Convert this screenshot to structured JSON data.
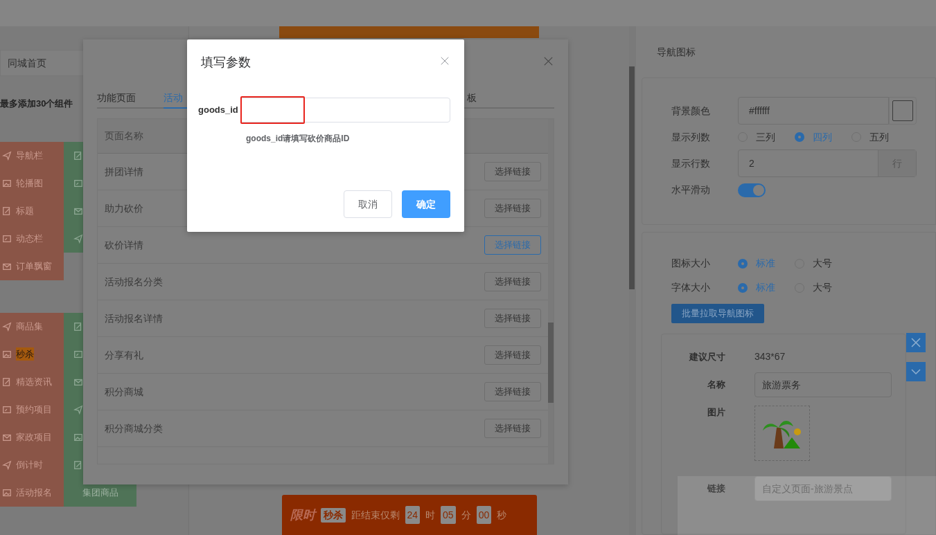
{
  "page_select": {
    "value": "同城首页"
  },
  "component_hint": "最多添加30个组件",
  "component_groups": [
    {
      "primary": [
        {
          "label": "导航栏",
          "highlighted": false
        },
        {
          "label": "轮播图",
          "highlighted": false
        },
        {
          "label": "标题",
          "highlighted": false
        },
        {
          "label": "动态栏",
          "highlighted": false
        },
        {
          "label": "订单飘窗",
          "highlighted": false
        }
      ],
      "secondary": [
        {
          "kind": "icon_only"
        },
        {
          "kind": "icon_only"
        },
        {
          "kind": "icon_only"
        },
        {
          "kind": "icon_only"
        }
      ]
    },
    {
      "primary": [
        {
          "label": "商品集",
          "highlighted": false
        },
        {
          "label": "秒杀",
          "highlighted": true
        },
        {
          "label": "精选资讯",
          "highlighted": false
        },
        {
          "label": "预约项目",
          "highlighted": false
        },
        {
          "label": "家政项目",
          "highlighted": false
        },
        {
          "label": "倒计时",
          "highlighted": false
        },
        {
          "label": "活动报名",
          "highlighted": false
        }
      ],
      "secondary": [
        {
          "kind": "icon_only"
        },
        {
          "kind": "icon_only"
        },
        {
          "kind": "icon_only"
        },
        {
          "kind": "icon_only"
        },
        {
          "kind": "icon_only"
        },
        {
          "kind": "icon_only"
        },
        {
          "kind": "text",
          "label": "集团商品"
        }
      ]
    }
  ],
  "flash_sale": {
    "title": "限时",
    "tag": "秒杀",
    "countdown_label": "距结束仅剩",
    "hours": "24",
    "hours_unit": "时",
    "minutes": "05",
    "minutes_unit": "分",
    "seconds": "00",
    "seconds_unit": "秒"
  },
  "link_modal": {
    "tabs": [
      {
        "label": "功能页面",
        "selected": false
      },
      {
        "label": "活动",
        "selected": true
      },
      {
        "label": "板",
        "selected": false
      }
    ],
    "column": "页面名称",
    "rows": [
      {
        "name": "拼团详情",
        "button": "选择链接",
        "selected": false
      },
      {
        "name": "助力砍价",
        "button": "选择链接",
        "selected": false
      },
      {
        "name": "砍价详情",
        "button": "选择链接",
        "selected": true
      },
      {
        "name": "活动报名分类",
        "button": "选择链接",
        "selected": false
      },
      {
        "name": "活动报名详情",
        "button": "选择链接",
        "selected": false
      },
      {
        "name": "分享有礼",
        "button": "选择链接",
        "selected": false
      },
      {
        "name": "积分商城",
        "button": "选择链接",
        "selected": false
      },
      {
        "name": "积分商城分类",
        "button": "选择链接",
        "selected": false
      }
    ]
  },
  "param_dialog": {
    "title": "填写参数",
    "field": {
      "label": "goods_id",
      "highlighted": true
    },
    "help": "goods_id请填写砍价商品ID",
    "buttons": [
      {
        "label": "取消",
        "kind": "secondary"
      },
      {
        "label": "确定",
        "kind": "primary"
      }
    ]
  },
  "settings": {
    "title": "导航图标",
    "background": {
      "label": "背景颜色",
      "value": "#ffffff"
    },
    "columns": {
      "label": "显示列数",
      "options": [
        {
          "label": "三列",
          "selected": false
        },
        {
          "label": "四列",
          "selected": true
        },
        {
          "label": "五列",
          "selected": false
        }
      ]
    },
    "rows": {
      "label": "显示行数",
      "value": "2",
      "unit": "行"
    },
    "scroll": {
      "label": "水平滑动",
      "on": true
    },
    "icon_size": {
      "label": "图标大小",
      "options": [
        {
          "label": "标准",
          "selected": true
        },
        {
          "label": "大号",
          "selected": false
        }
      ]
    },
    "font_size": {
      "label": "字体大小",
      "options": [
        {
          "label": "标准",
          "selected": true
        },
        {
          "label": "大号",
          "selected": false
        }
      ]
    },
    "batch_button": "批量拉取导航图标",
    "nav_item": {
      "size_label": "建议尺寸",
      "size_value": "343*67",
      "name_label": "名称",
      "name_value": "旅游票务",
      "image_label": "图片",
      "link_label": "链接",
      "link_value": "自定义页面-旅游景点"
    }
  }
}
